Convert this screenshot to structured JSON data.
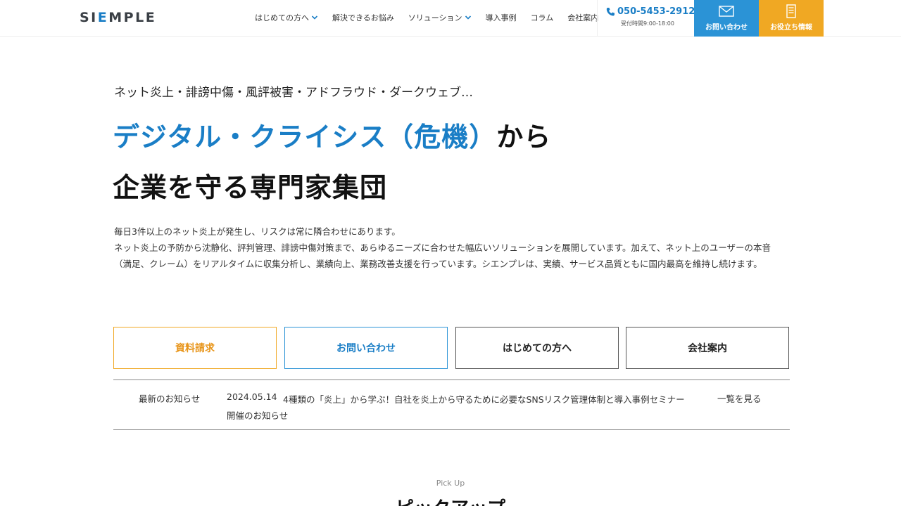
{
  "header": {
    "logo_prefix": "SI",
    "logo_accent": "E",
    "logo_suffix": "MPLE",
    "nav": [
      {
        "label": "はじめての方へ",
        "has_dropdown": true
      },
      {
        "label": "解決できるお悩み",
        "has_dropdown": false
      },
      {
        "label": "ソリューション",
        "has_dropdown": true
      },
      {
        "label": "導入事例",
        "has_dropdown": false
      },
      {
        "label": "コラム",
        "has_dropdown": false
      },
      {
        "label": "会社案内",
        "has_dropdown": false
      }
    ],
    "phone": "050-5453-2912",
    "hours": "受付時間9:00-18:00",
    "contact_label": "お問い合わせ",
    "info_label": "お役立ち情報"
  },
  "hero": {
    "lead": "ネット炎上・誹謗中傷・風評被害・アドフラウド・ダークウェブ…",
    "headline_blue": "デジタル・クライシス（危機）",
    "headline_dark": "から",
    "headline_line2": "企業を守る専門家集団",
    "desc_line1": "毎日3件以上のネット炎上が発生し、リスクは常に隣合わせにあります。",
    "desc_line2": "ネット炎上の予防から沈静化、評判管理、誹謗中傷対策まで、あらゆるニーズに合わせた幅広いソリューションを展開しています。加えて、ネット上のユーザーの本音（満足、クレーム）をリアルタイムに収集分析し、業績向上、業務改善支援を行っています。シエンプレは、実績、サービス品質ともに国内最高を維持し続けます。"
  },
  "cta": [
    {
      "label": "資料請求"
    },
    {
      "label": "お問い合わせ"
    },
    {
      "label": "はじめての方へ"
    },
    {
      "label": "会社案内"
    }
  ],
  "news": {
    "label": "最新のお知らせ",
    "date": "2024.05.14",
    "text": "4種類の「炎上」から学ぶ！自社を炎上から守るために必要なSNSリスク管理体制と導入事例セミナー開催のお知らせ",
    "more": "一覧を見る"
  },
  "pickup": {
    "en": "Pick Up",
    "ja": "ピックアップ"
  },
  "colors": {
    "accent_blue": "#1a7ec6",
    "contact_bg": "#2b93d6",
    "info_bg": "#f0a823"
  }
}
